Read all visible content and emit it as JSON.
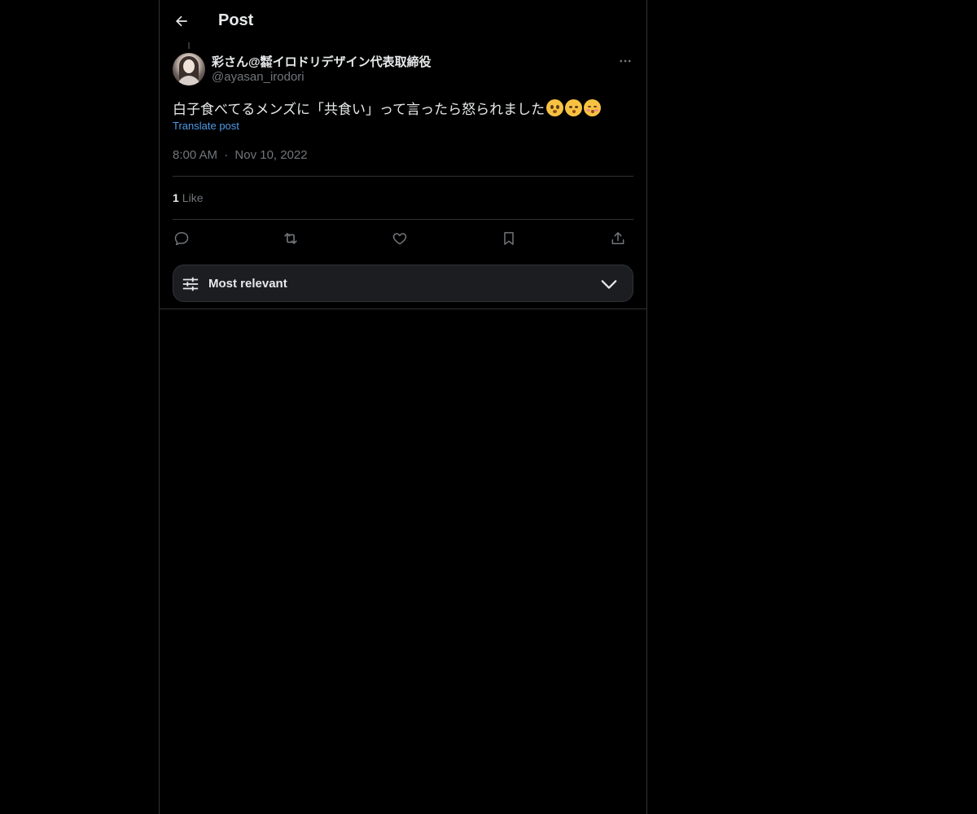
{
  "header": {
    "title": "Post",
    "back_icon": "arrow-left-icon"
  },
  "author": {
    "display_name": "彩さん@㍿イロドリデザイン代表取締役",
    "handle": "@ayasan_irodori"
  },
  "post": {
    "text": "白子食べてるメンズに「共食い」って言ったら怒られました",
    "emojis": [
      "pleading-face-emoji",
      "kissing-face-emoji",
      "face-blowing-kiss-emoji"
    ],
    "translate_label": "Translate post",
    "time": "8:00 AM",
    "separator": "·",
    "date": "Nov 10, 2022"
  },
  "stats": {
    "likes_count": "1",
    "likes_label": "Like"
  },
  "actions": [
    "reply-icon",
    "repost-icon",
    "like-icon",
    "bookmark-icon",
    "share-icon"
  ],
  "sort": {
    "label": "Most relevant"
  },
  "colors": {
    "background": "#000000",
    "text": "#e7e9ea",
    "muted": "#71767b",
    "link": "#4e9be8",
    "border": "#2f3336"
  }
}
